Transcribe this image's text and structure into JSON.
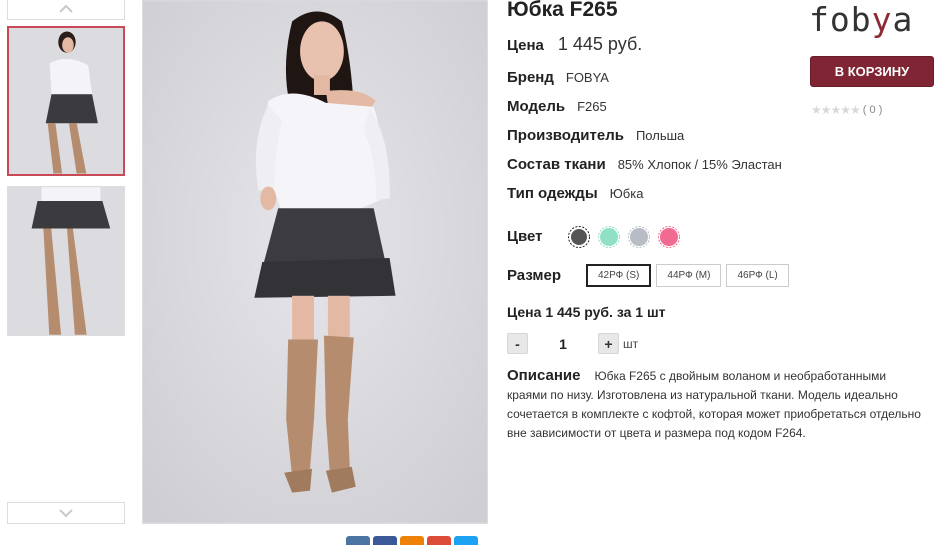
{
  "product": {
    "title": "Юбка F265",
    "price_label": "Цена",
    "price_value": "1 445 руб.",
    "attributes": [
      {
        "label": "Бренд",
        "value": "FOBYA"
      },
      {
        "label": "Модель",
        "value": "F265"
      },
      {
        "label": "Производитель",
        "value": "Польша"
      },
      {
        "label": "Состав ткани",
        "value": "85% Хлопок / 15% Эластан"
      },
      {
        "label": "Тип одежды",
        "value": "Юбка"
      }
    ],
    "color_label": "Цвет",
    "colors": [
      {
        "name": "dark-gray",
        "hex": "#555555",
        "selected": true
      },
      {
        "name": "mint",
        "hex": "#8fe0c4",
        "selected": false
      },
      {
        "name": "light-gray",
        "hex": "#b8bcc4",
        "selected": false
      },
      {
        "name": "pink",
        "hex": "#f06a92",
        "selected": false
      }
    ],
    "size_label": "Размер",
    "sizes": [
      {
        "label": "42РФ (S)",
        "selected": true
      },
      {
        "label": "44РФ (M)",
        "selected": false
      },
      {
        "label": "46РФ (L)",
        "selected": false
      }
    ],
    "total_text": "Цена 1 445 руб. за 1 шт",
    "quantity": {
      "minus": "-",
      "value": "1",
      "plus": "+",
      "unit": "шт"
    },
    "description_label": "Описание",
    "description_text": "Юбка F265 с двойным воланом и необработанными краями по низу. Изготовлена из натуральной ткани. Модель идеально сочетается в комплекте с кофтой, которая может приобретаться отдельно вне зависимости от цвета и размера под кодом F264."
  },
  "brand_logo": {
    "part1": "fob",
    "part2": "y",
    "part3": "a"
  },
  "cart_button": "В КОРЗИНУ",
  "rating": {
    "stars": "★★★★★",
    "count": "( 0 )"
  },
  "colors": {
    "accent": "#7f2533",
    "active_thumb_border": "#c94a56"
  },
  "share_icons": [
    {
      "name": "vk-icon",
      "color": "#4c75a3"
    },
    {
      "name": "facebook-icon",
      "color": "#3b5998"
    },
    {
      "name": "odnoklassniki-icon",
      "color": "#ee8208"
    },
    {
      "name": "google-plus-icon",
      "color": "#dd4b39"
    },
    {
      "name": "twitter-icon",
      "color": "#1da1f2"
    }
  ]
}
